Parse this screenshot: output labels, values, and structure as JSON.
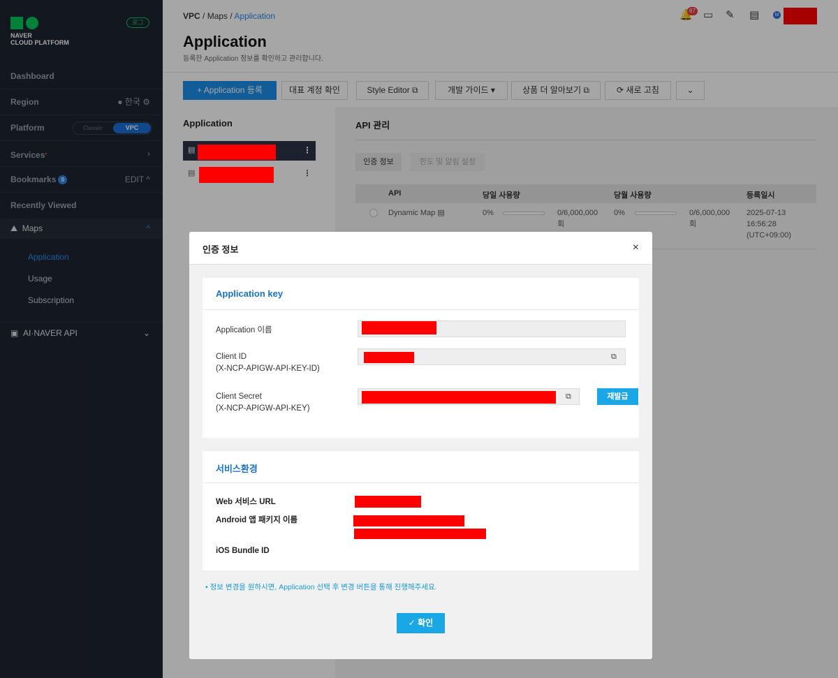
{
  "sidebar": {
    "logo_line1": "NAVER",
    "logo_line2": "CLOUD PLATFORM",
    "logout": "로그",
    "dashboard": "Dashboard",
    "region_label": "Region",
    "region_value": "한국",
    "platform_label": "Platform",
    "platform_classic": "Classic",
    "platform_vpc": "VPC",
    "services": "Services",
    "bookmarks": "Bookmarks",
    "bookmarks_count": "0",
    "bookmarks_edit": "EDIT",
    "recently_viewed": "Recently Viewed",
    "maps": "Maps",
    "sub_items": [
      "Application",
      "Usage",
      "Subscription"
    ],
    "ainaver": "AI·NAVER API"
  },
  "header": {
    "crumb1": "VPC",
    "crumb2": "Maps",
    "crumb3": "Application",
    "title": "Application",
    "subtitle": "등록한 Application 정보를 확인하고 관리합니다.",
    "notifications": "67",
    "avatar": "M"
  },
  "toolbar": {
    "register": "+ Application 등록",
    "confirm_account": "대표 계정 확인",
    "style_editor": "Style Editor ⧉",
    "dev_guide": "개발 가이드 ▾",
    "learn_more": "상품 더 알아보기 ⧉",
    "refresh": "⟳ 새로 고침",
    "more": "⌄"
  },
  "left_panel": {
    "heading": "Application"
  },
  "api_panel": {
    "heading": "API 관리",
    "tab_active": "인증 정보",
    "tab_inactive": "한도 및 알림 설정",
    "columns": [
      "API",
      "당일 사용량",
      "당월 사용량",
      "등록일시"
    ],
    "row": {
      "api": "Dynamic Map",
      "daily_pct": "0%",
      "daily_usage": "0/6,000,000",
      "daily_unit": "회",
      "monthly_pct": "0%",
      "monthly_usage": "0/6,000,000",
      "monthly_unit": "회",
      "date": "2025-07-13",
      "time": "16:56:28",
      "tz": "(UTC+09:00)"
    }
  },
  "modal": {
    "title": "인증 정보",
    "close": "×",
    "app_key": {
      "title": "Application key",
      "app_name_label": "Application 이름",
      "client_id_label": "Client ID",
      "client_id_sub": "(X-NCP-APIGW-API-KEY-ID)",
      "client_secret_label": "Client Secret",
      "client_secret_sub": "(X-NCP-APIGW-API-KEY)",
      "reissue": "재발급"
    },
    "service": {
      "title": "서비스환경",
      "web_url": "Web 서비스 URL",
      "android": "Android 앱 패키지 이름",
      "ios": "iOS Bundle ID"
    },
    "note": "• 정보 변경을 원하시면, Application 선택 후 변경 버튼을 통해 진행해주세요.",
    "ok": "✓ 확인"
  },
  "colors": {
    "primary": "#1d8fe8",
    "accent": "#1aa7e6",
    "sidebar_bg": "#1e2430",
    "naver_green": "#03c75a"
  }
}
